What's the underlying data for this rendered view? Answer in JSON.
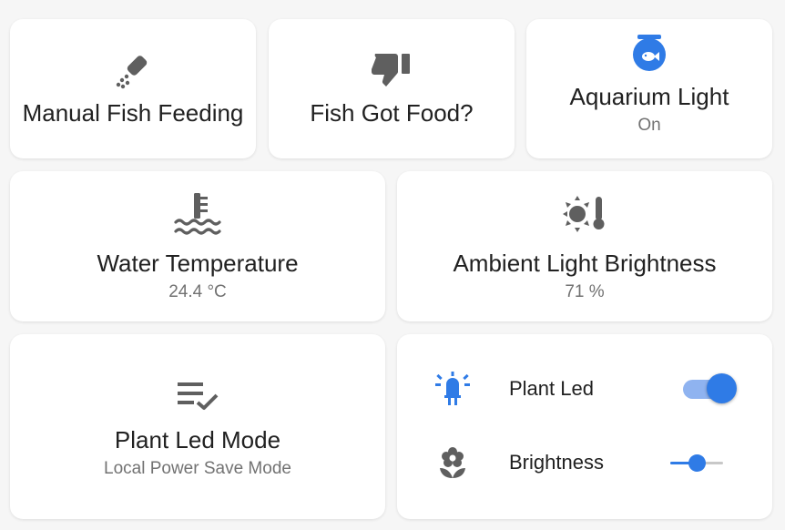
{
  "colors": {
    "accent": "#2f7be6",
    "icon_gray": "#5f5f5f",
    "background": "#f6f6f6"
  },
  "cards": {
    "manual_feeding": {
      "title": "Manual Fish Feeding",
      "icon": "shaker-icon"
    },
    "fish_got_food": {
      "title": "Fish Got Food?",
      "icon": "thumb-down-icon"
    },
    "aquarium_light": {
      "title": "Aquarium Light",
      "state": "On",
      "icon": "fishbowl-icon"
    },
    "water_temperature": {
      "title": "Water Temperature",
      "state": "24.4 °C",
      "icon": "water-thermometer-icon"
    },
    "ambient_light": {
      "title": "Ambient Light Brightness",
      "state": "71 %",
      "icon": "sun-thermometer-icon"
    },
    "plant_led_mode": {
      "title": "Plant Led Mode",
      "state": "Local Power Save Mode",
      "icon": "format-list-checks-icon"
    },
    "plant_led_entities": {
      "plant_led": {
        "label": "Plant Led",
        "icon": "led-on-icon",
        "toggle_on": true
      },
      "brightness": {
        "label": "Brightness",
        "icon": "flower-icon",
        "slider_value": 0.5
      }
    }
  }
}
